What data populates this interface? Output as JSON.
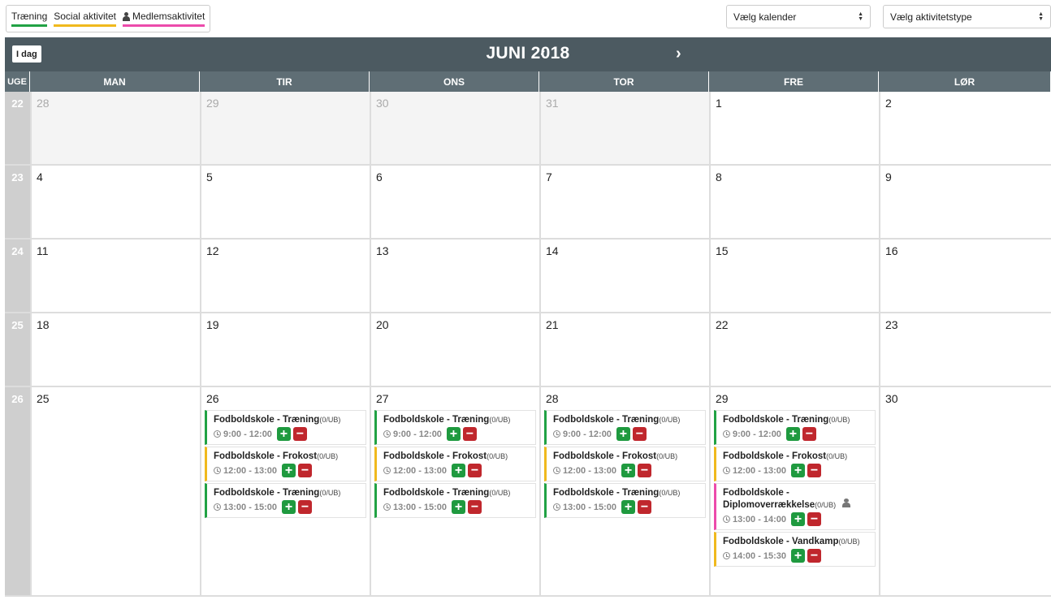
{
  "legend": [
    {
      "label": "Træning",
      "color": "#21a244",
      "icon": null
    },
    {
      "label": "Social aktivitet",
      "color": "#f0b91d",
      "icon": null
    },
    {
      "label": "Medlemsaktivitet",
      "color": "#ec4bab",
      "icon": "person-icon"
    }
  ],
  "selects": {
    "calendar": "Vælg kalender",
    "activity_type": "Vælg aktivitetstype"
  },
  "header": {
    "today_label": "I dag",
    "month_title": "JUNI 2018",
    "prev_icon": "chevron-left-icon",
    "next_icon": "chevron-right-icon"
  },
  "columns": [
    "UGE",
    "MAN",
    "TIR",
    "ONS",
    "TOR",
    "FRE",
    "LØR"
  ],
  "colors": {
    "training": "#21a244",
    "social": "#f0b91d",
    "member": "#ec4bab",
    "add": "#1f9a3f",
    "remove": "#c0272d"
  },
  "weeks": [
    {
      "num": "22",
      "days": [
        {
          "d": "28",
          "other": true
        },
        {
          "d": "29",
          "other": true
        },
        {
          "d": "30",
          "other": true
        },
        {
          "d": "31",
          "other": true
        },
        {
          "d": "1"
        },
        {
          "d": "2"
        }
      ]
    },
    {
      "num": "23",
      "days": [
        {
          "d": "4"
        },
        {
          "d": "5"
        },
        {
          "d": "6"
        },
        {
          "d": "7"
        },
        {
          "d": "8"
        },
        {
          "d": "9"
        }
      ]
    },
    {
      "num": "24",
      "days": [
        {
          "d": "11"
        },
        {
          "d": "12"
        },
        {
          "d": "13"
        },
        {
          "d": "14"
        },
        {
          "d": "15"
        },
        {
          "d": "16"
        }
      ]
    },
    {
      "num": "25",
      "days": [
        {
          "d": "18"
        },
        {
          "d": "19"
        },
        {
          "d": "20"
        },
        {
          "d": "21"
        },
        {
          "d": "22"
        },
        {
          "d": "23"
        }
      ]
    },
    {
      "num": "26",
      "days": [
        {
          "d": "25"
        },
        {
          "d": "26",
          "events": [
            {
              "title": "Fodboldskole - Træning",
              "cap": "(0/UB)",
              "time": "9:00 - 12:00",
              "type": "training"
            },
            {
              "title": "Fodboldskole - Frokost",
              "cap": "(0/UB)",
              "time": "12:00 - 13:00",
              "type": "social"
            },
            {
              "title": "Fodboldskole - Træning",
              "cap": "(0/UB)",
              "time": "13:00 - 15:00",
              "type": "training"
            }
          ]
        },
        {
          "d": "27",
          "events": [
            {
              "title": "Fodboldskole - Træning",
              "cap": "(0/UB)",
              "time": "9:00 - 12:00",
              "type": "training"
            },
            {
              "title": "Fodboldskole - Frokost",
              "cap": "(0/UB)",
              "time": "12:00 - 13:00",
              "type": "social"
            },
            {
              "title": "Fodboldskole - Træning",
              "cap": "(0/UB)",
              "time": "13:00 - 15:00",
              "type": "training"
            }
          ]
        },
        {
          "d": "28",
          "events": [
            {
              "title": "Fodboldskole - Træning",
              "cap": "(0/UB)",
              "time": "9:00 - 12:00",
              "type": "training"
            },
            {
              "title": "Fodboldskole - Frokost",
              "cap": "(0/UB)",
              "time": "12:00 - 13:00",
              "type": "social"
            },
            {
              "title": "Fodboldskole - Træning",
              "cap": "(0/UB)",
              "time": "13:00 - 15:00",
              "type": "training"
            }
          ]
        },
        {
          "d": "29",
          "events": [
            {
              "title": "Fodboldskole - Træning",
              "cap": "(0/UB)",
              "time": "9:00 - 12:00",
              "type": "training"
            },
            {
              "title": "Fodboldskole - Frokost",
              "cap": "(0/UB)",
              "time": "12:00 - 13:00",
              "type": "social"
            },
            {
              "title": "Fodboldskole - Diplomoverrækkelse",
              "cap": "(0/UB)",
              "time": "13:00 - 14:00",
              "type": "member",
              "member": true
            },
            {
              "title": "Fodboldskole - Vandkamp",
              "cap": "(0/UB)",
              "time": "14:00 - 15:30",
              "type": "social"
            }
          ]
        },
        {
          "d": "30"
        }
      ]
    }
  ]
}
